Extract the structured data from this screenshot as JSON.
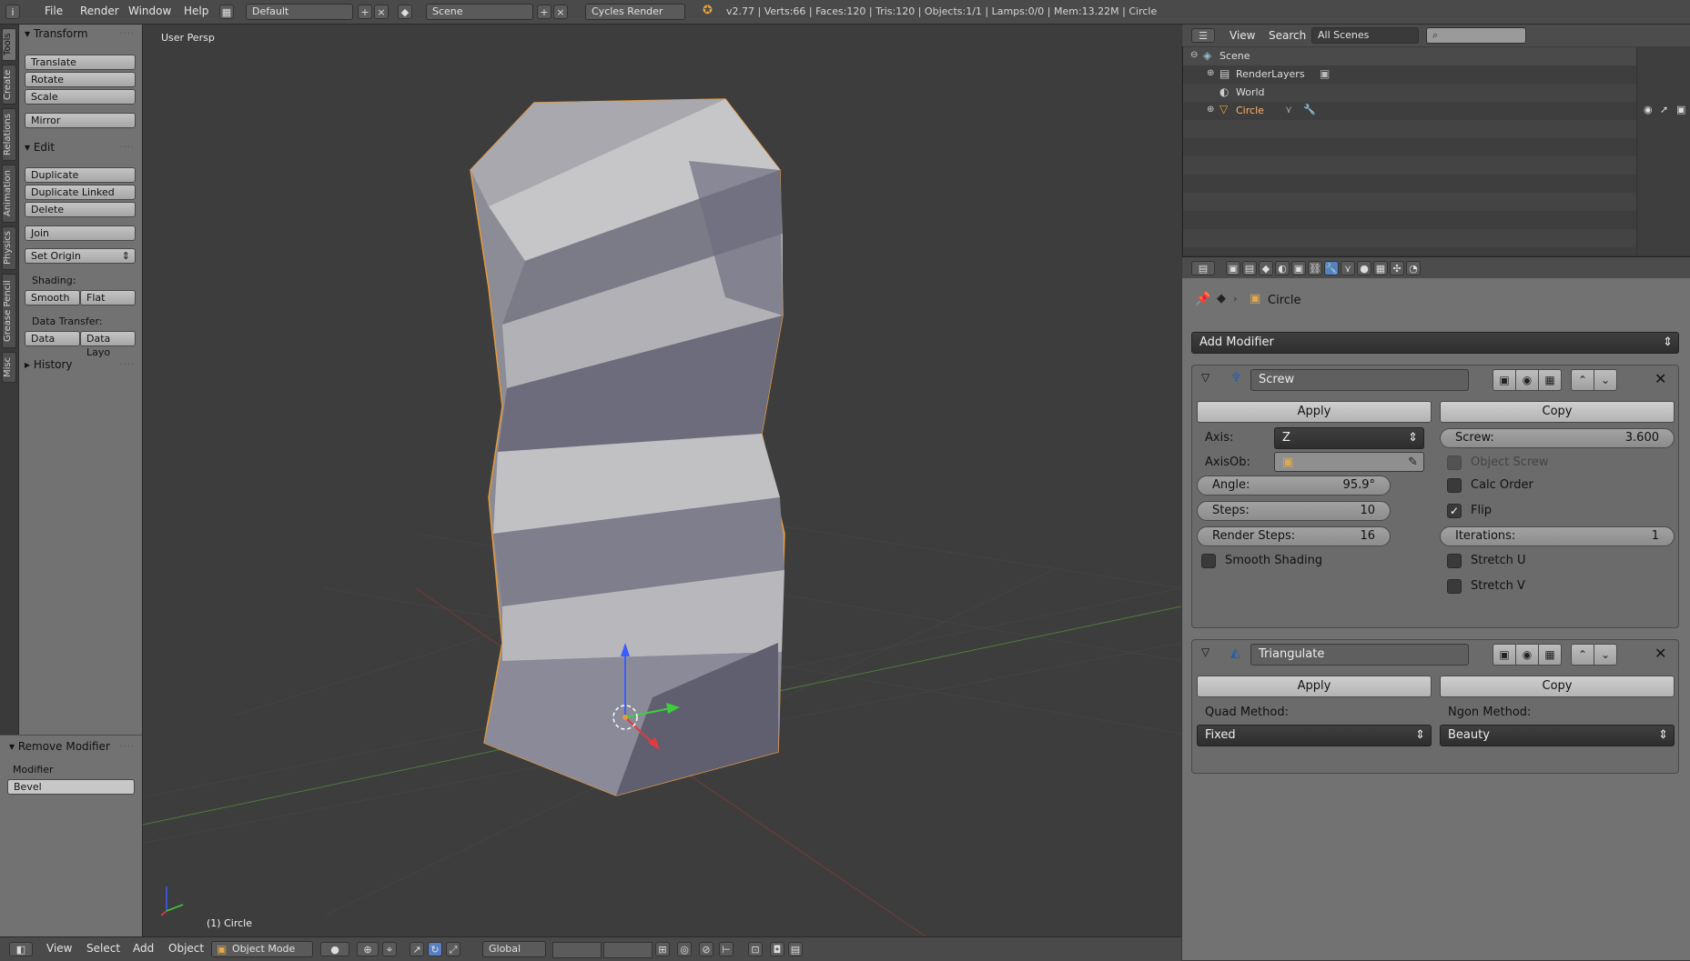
{
  "topbar": {
    "menus": [
      "File",
      "Render",
      "Window",
      "Help"
    ],
    "screen_layout": "Default",
    "scene": "Scene",
    "render_engine": "Cycles Render",
    "stats": "v2.77 | Verts:66 | Faces:120 | Tris:120 | Objects:1/1 | Lamps:0/0 | Mem:13.22M | Circle"
  },
  "tool_tabs": [
    "Tools",
    "Create",
    "Relations",
    "Animation",
    "Physics",
    "Grease Pencil",
    "Misc"
  ],
  "toolshelf": {
    "transform": {
      "title": "Transform",
      "buttons": [
        "Translate",
        "Rotate",
        "Scale",
        "Mirror"
      ]
    },
    "edit": {
      "title": "Edit",
      "buttons": [
        "Duplicate",
        "Duplicate Linked",
        "Delete",
        "Join"
      ],
      "set_origin": "Set Origin"
    },
    "shading": {
      "label": "Shading:",
      "smooth": "Smooth",
      "flat": "Flat"
    },
    "data_transfer": {
      "label": "Data Transfer:",
      "data": "Data",
      "data_layout": "Data Layo"
    },
    "history": "History",
    "operator": {
      "title": "Remove Modifier",
      "label": "Modifier",
      "value": "Bevel"
    }
  },
  "viewport": {
    "view_name": "User Persp",
    "object_label": "(1) Circle"
  },
  "bottombar": {
    "menus": [
      "View",
      "Select",
      "Add",
      "Object"
    ],
    "mode": "Object Mode",
    "orientation": "Global"
  },
  "outliner": {
    "header_menus": [
      "View",
      "Search"
    ],
    "filter": "All Scenes",
    "items": [
      {
        "label": "Scene"
      },
      {
        "label": "RenderLayers"
      },
      {
        "label": "World"
      },
      {
        "label": "Circle"
      }
    ]
  },
  "properties": {
    "breadcrumb_object": "Circle",
    "add_modifier": "Add Modifier",
    "screw": {
      "name": "Screw",
      "apply": "Apply",
      "copy": "Copy",
      "axis_label": "Axis:",
      "axis_value": "Z",
      "axisob_label": "AxisOb:",
      "screw_label": "Screw:",
      "screw_value": "3.600",
      "object_screw": "Object Screw",
      "angle_label": "Angle:",
      "angle_value": "95.9°",
      "calc_order": "Calc Order",
      "steps_label": "Steps:",
      "steps_value": "10",
      "flip": "Flip",
      "render_steps_label": "Render Steps:",
      "render_steps_value": "16",
      "iterations_label": "Iterations:",
      "iterations_value": "1",
      "smooth_shading": "Smooth Shading",
      "stretch_u": "Stretch U",
      "stretch_v": "Stretch V",
      "object_screw_checked": false,
      "calc_order_checked": false,
      "flip_checked": true,
      "smooth_shading_checked": false,
      "stretch_u_checked": false,
      "stretch_v_checked": false
    },
    "triangulate": {
      "name": "Triangulate",
      "apply": "Apply",
      "copy": "Copy",
      "quad_label": "Quad Method:",
      "quad_value": "Fixed",
      "ngon_label": "Ngon Method:",
      "ngon_value": "Beauty"
    }
  }
}
